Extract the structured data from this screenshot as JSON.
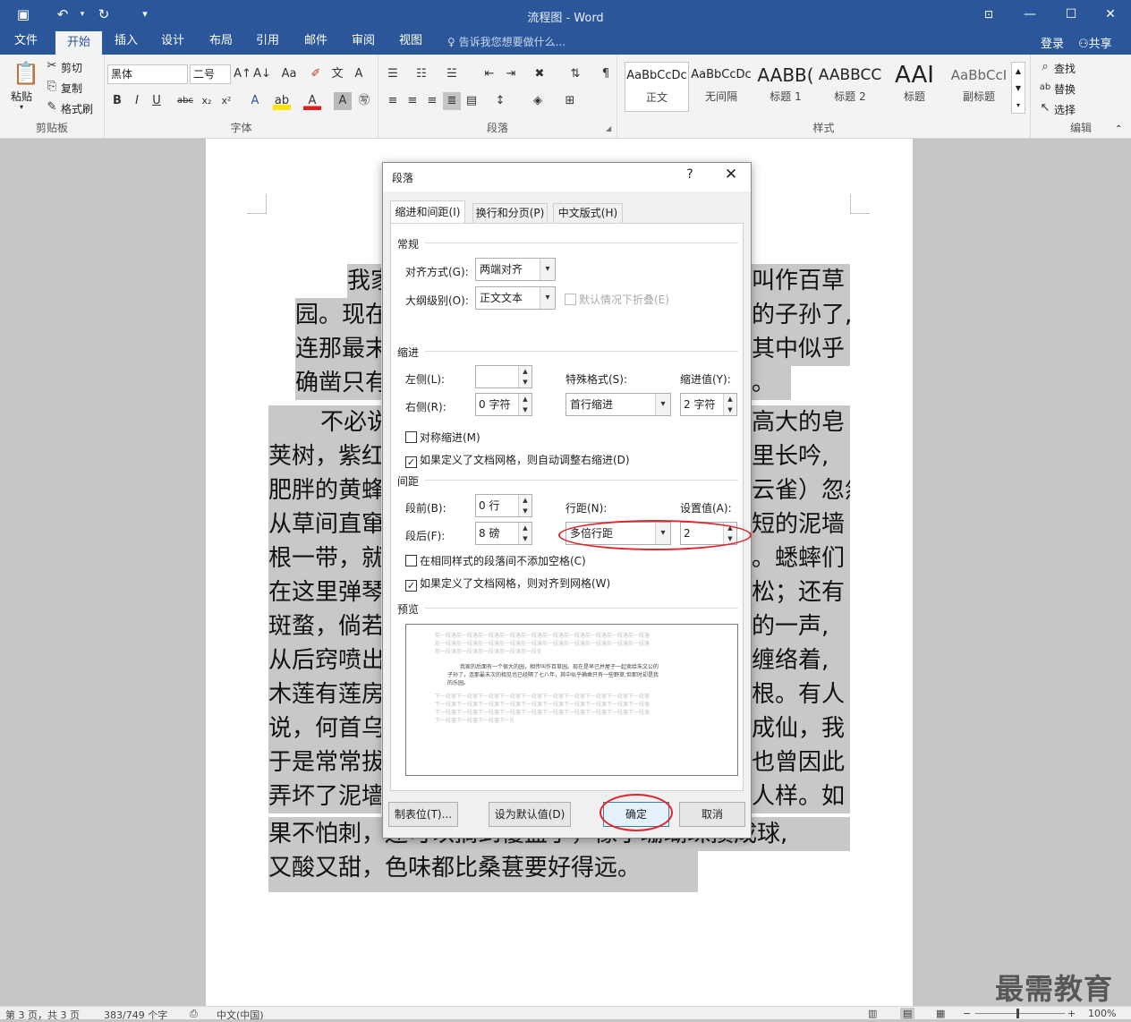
{
  "window": {
    "title": "流程图 - Word",
    "qa_save": "save-icon",
    "qa_undo": "undo-icon",
    "qa_redo": "redo-icon",
    "qa_customize": "customize-icon"
  },
  "menu": {
    "tabs": [
      "文件",
      "开始",
      "插入",
      "设计",
      "布局",
      "引用",
      "邮件",
      "审阅",
      "视图"
    ],
    "active_tab": "开始",
    "tell_me": "告诉我您想要做什么...",
    "login": "登录",
    "share": "共享"
  },
  "ribbon": {
    "clipboard": {
      "label": "剪贴板",
      "paste": "粘贴",
      "cut": "剪切",
      "copy": "复制",
      "format_painter": "格式刷"
    },
    "font": {
      "label": "字体",
      "font_name": "黑体",
      "font_size": "二号"
    },
    "paragraph": {
      "label": "段落"
    },
    "styles": {
      "label": "样式",
      "items": [
        {
          "sample": "AaBbCcDc",
          "name": "正文"
        },
        {
          "sample": "AaBbCcDc",
          "name": "无间隔"
        },
        {
          "sample": "AABB(",
          "name": "标题 1"
        },
        {
          "sample": "AABBCC",
          "name": "标题 2"
        },
        {
          "sample": "AAI",
          "name": "标题"
        },
        {
          "sample": "AaBbCcI",
          "name": "副标题"
        }
      ]
    },
    "editing": {
      "label": "编辑",
      "find": "查找",
      "replace": "替换",
      "select": "选择"
    }
  },
  "document": {
    "lines": [
      "我家",
      "叫作百草",
      "园。现在",
      "的子孙了,",
      "连那最末",
      "其中似乎",
      "确凿只有",
      "。",
      "不必说",
      "高大的皂",
      "荚树，紫红",
      "里长吟,",
      "肥胖的黄蜂",
      "云雀）忽然",
      "从草间直窜",
      "短的泥墙",
      "根一带，就",
      "。蟋蟀们",
      "在这里弹琴",
      "松；还有",
      "斑蝥，倘若",
      "的一声,",
      "从后窍喷出",
      "缠络着,",
      "木莲有莲房",
      "根。有人",
      "说，何首乌",
      "成仙，我",
      "于是常常拔",
      "也曾因此",
      "弄坏了泥墙",
      "人样。如",
      "果不怕刺，还可以摘到覆盆子，像小珊瑚珠攒成球,",
      "又酸又甜，色味都比桑葚要好得远。"
    ]
  },
  "status": {
    "page": "第 3 页，共 3 页",
    "words": "383/749 个字",
    "language": "中文(中国)",
    "zoom": "100%"
  },
  "watermark": "最需教育",
  "dialog": {
    "title": "段落",
    "help": "?",
    "tabs": [
      "缩进和间距(I)",
      "换行和分页(P)",
      "中文版式(H)"
    ],
    "general": {
      "heading": "常规",
      "alignment_label": "对齐方式(G):",
      "alignment_value": "两端对齐",
      "outline_label": "大纲级别(O):",
      "outline_value": "正文文本",
      "collapse_label": "默认情况下折叠(E)"
    },
    "indent": {
      "heading": "缩进",
      "left_label": "左侧(L):",
      "left_value": "",
      "right_label": "右侧(R):",
      "right_value": "0 字符",
      "special_label": "特殊格式(S):",
      "special_value": "首行缩进",
      "by_label": "缩进值(Y):",
      "by_value": "2 字符",
      "mirror_label": "对称缩进(M)",
      "mirror_checked": false,
      "auto_adjust_label": "如果定义了文档网格，则自动调整右缩进(D)",
      "auto_adjust_checked": true
    },
    "spacing": {
      "heading": "间距",
      "before_label": "段前(B):",
      "before_value": "0 行",
      "after_label": "段后(F):",
      "after_value": "8 磅",
      "line_label": "行距(N):",
      "line_value": "多倍行距",
      "at_label": "设置值(A):",
      "at_value": "2",
      "no_space_label": "在相同样式的段落间不添加空格(C)",
      "no_space_checked": false,
      "snap_grid_label": "如果定义了文档网格，则对齐到网格(W)",
      "snap_grid_checked": true
    },
    "preview": {
      "heading": "预览",
      "sample_text_1": "我家的后面有一个很大的园，相传叫作百草园。现在是早已并屋子一起卖给朱文公的",
      "sample_text_2": "子孙了，连那最末次的相见也已经隔了七八年，其中似乎确凿只有一些野草;但那时却是我",
      "sample_text_3": "的乐园。",
      "prev_text": "前一段落前一段落前一段落前一段落前一段落前一段落前一段落前一段落前一段落前一段落",
      "next_text": "下一段落下一段落下一段落下一段落下一段落下一段落下一段落下一段落下一段落下一段落"
    },
    "buttons": {
      "tabs": "制表位(T)...",
      "set_default": "设为默认值(D)",
      "ok": "确定",
      "cancel": "取消"
    }
  }
}
